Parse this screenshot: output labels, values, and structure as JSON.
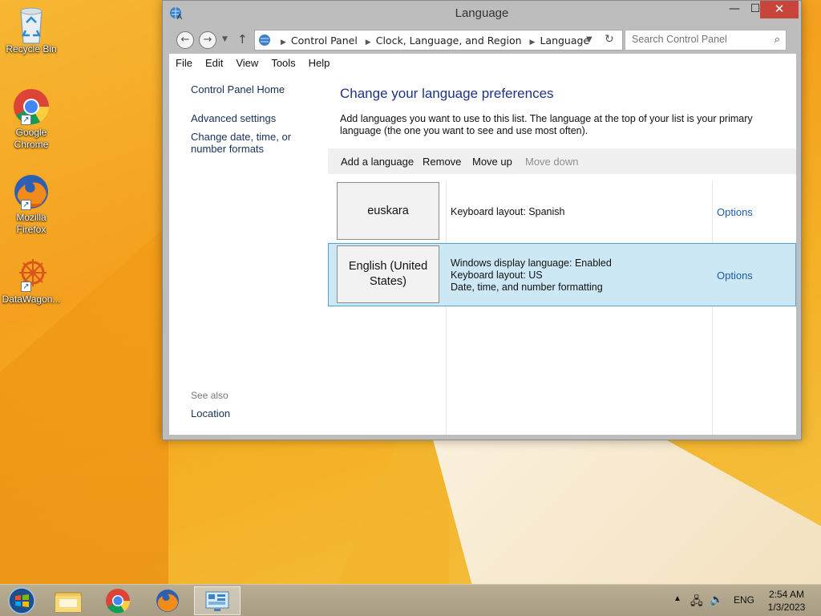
{
  "desktop": {
    "icons": [
      {
        "label": "Recycle Bin",
        "icon": "recycle-bin-icon"
      },
      {
        "label": "Google Chrome",
        "icon": "chrome-icon"
      },
      {
        "label": "Mozilla Firefox",
        "icon": "firefox-icon"
      },
      {
        "label": "DataWagon...",
        "icon": "datawagon-icon"
      }
    ]
  },
  "window": {
    "title": "Language",
    "close_glyph": "✕",
    "min_glyph": "—",
    "max_glyph": "☐"
  },
  "address": {
    "crumbs": [
      "Control Panel",
      "Clock, Language, and Region",
      "Language"
    ],
    "search_placeholder": "Search Control Panel"
  },
  "menu": [
    "File",
    "Edit",
    "View",
    "Tools",
    "Help"
  ],
  "left_pane": {
    "home": "Control Panel Home",
    "advanced": "Advanced settings",
    "date_formats": "Change date, time, or number formats",
    "see_also": "See also",
    "location": "Location"
  },
  "main": {
    "heading": "Change your language preferences",
    "description": "Add languages you want to use to this list. The language at the top of your list is your primary language (the one you want to see and use most often).",
    "toolbar": {
      "add": "Add a language",
      "remove": "Remove",
      "move_up": "Move up",
      "move_down": "Move down"
    },
    "languages": [
      {
        "name": "euskara",
        "info": [
          "Keyboard layout: Spanish"
        ],
        "options": "Options",
        "selected": false
      },
      {
        "name": "English (United States)",
        "info": [
          "Windows display language: Enabled",
          "Keyboard layout: US",
          "Date, time, and number formatting"
        ],
        "options": "Options",
        "selected": true
      }
    ]
  },
  "taskbar": {
    "apps": [
      "start-orb-icon",
      "file-explorer-icon",
      "chrome-icon",
      "firefox-icon",
      "control-panel-icon"
    ],
    "language": "ENG",
    "time": "2:54 AM",
    "date": "1/3/2023"
  },
  "colors": {
    "accent_link": "#1c5bab",
    "heading": "#1e3287",
    "selection": "#cce8f4",
    "close_button": "#c7453a"
  }
}
